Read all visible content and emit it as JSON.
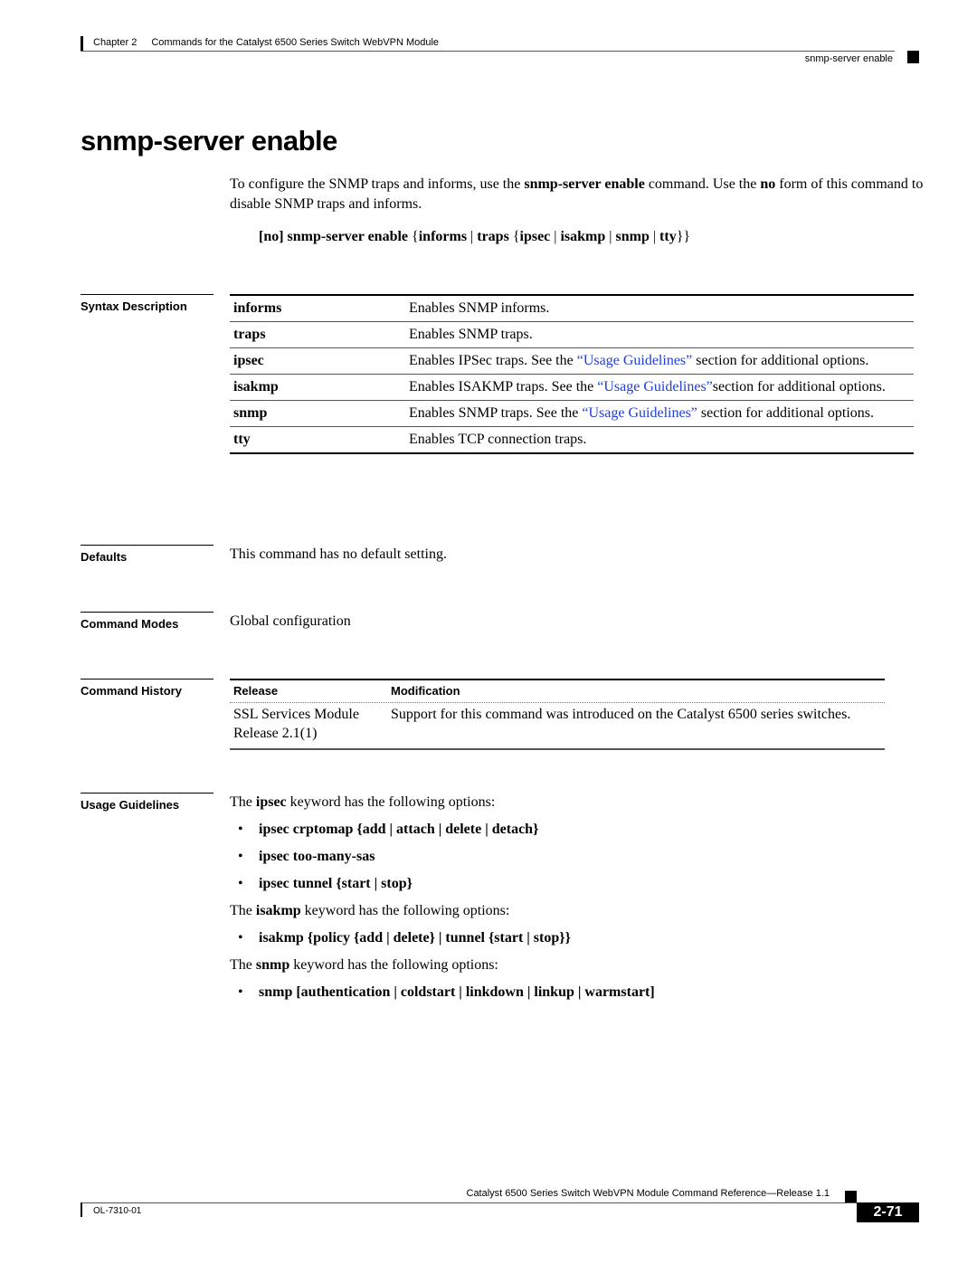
{
  "header": {
    "chapter": "Chapter 2",
    "chapter_title": "Commands for the Catalyst 6500 Series Switch WebVPN Module",
    "section": "snmp-server enable"
  },
  "title": "snmp-server enable",
  "intro": {
    "t1": "To configure the SNMP traps and informs, use the ",
    "b1": "snmp-server enable",
    "t2": " command. Use the ",
    "b2": "no",
    "t3": " form of this command to disable SNMP traps and informs."
  },
  "syntax": {
    "p1": "[no] snmp-server enable ",
    "p2": "{",
    "p3": "informs",
    "p4": " | ",
    "p5": "traps",
    "p6": " {",
    "p7": "ipsec",
    "p8": " | ",
    "p9": "isakmp",
    "p10": " | ",
    "p11": "snmp",
    "p12": " | ",
    "p13": "tty",
    "p14": "}}"
  },
  "sections": {
    "syntax_description": "Syntax Description",
    "defaults": "Defaults",
    "command_modes": "Command Modes",
    "command_history": "Command History",
    "usage_guidelines": "Usage Guidelines"
  },
  "syntax_table": [
    {
      "keyword": "informs",
      "desc": "Enables SNMP informs.",
      "link": "",
      "after": ""
    },
    {
      "keyword": "traps",
      "desc": "Enables SNMP traps.",
      "link": "",
      "after": ""
    },
    {
      "keyword": "ipsec",
      "desc": "Enables IPSec traps. See the ",
      "link": "“Usage Guidelines”",
      "after": " section for additional options."
    },
    {
      "keyword": "isakmp",
      "desc": "Enables ISAKMP traps. See the ",
      "link": "“Usage Guidelines”",
      "after": "section for additional options."
    },
    {
      "keyword": "snmp",
      "desc": "Enables SNMP traps. See the ",
      "link": "“Usage Guidelines”",
      "after": " section for additional options."
    },
    {
      "keyword": "tty",
      "desc": "Enables TCP connection traps.",
      "link": "",
      "after": ""
    }
  ],
  "defaults": "This command has no default setting.",
  "command_modes": "Global configuration",
  "command_history": {
    "headers": [
      "Release",
      "Modification"
    ],
    "rows": [
      {
        "release": "SSL Services Module Release 2.1(1)",
        "modification": "Support for this command was introduced on the Catalyst 6500 series switches."
      }
    ]
  },
  "usage": {
    "ipsec_intro": {
      "t1": "The ",
      "b": "ipsec",
      "t2": " keyword has the following options:"
    },
    "ipsec_options": [
      "ipsec crptomap {add | attach | delete | detach}",
      "ipsec too-many-sas",
      "ipsec tunnel {start | stop}"
    ],
    "isakmp_intro": {
      "t1": "The ",
      "b": "isakmp",
      "t2": " keyword has the following options:"
    },
    "isakmp_options": [
      "isakmp {policy {add | delete} | tunnel {start | stop}}"
    ],
    "snmp_intro": {
      "t1": "The ",
      "b": "snmp",
      "t2": " keyword has the following options:"
    },
    "snmp_options": [
      "snmp [authentication | coldstart | linkdown | linkup | warmstart]"
    ],
    "bullet": "•"
  },
  "footer": {
    "book_title": "Catalyst 6500 Series Switch WebVPN Module Command Reference—Release 1.1",
    "doc_number": "OL-7310-01",
    "page_number": "2-71"
  }
}
